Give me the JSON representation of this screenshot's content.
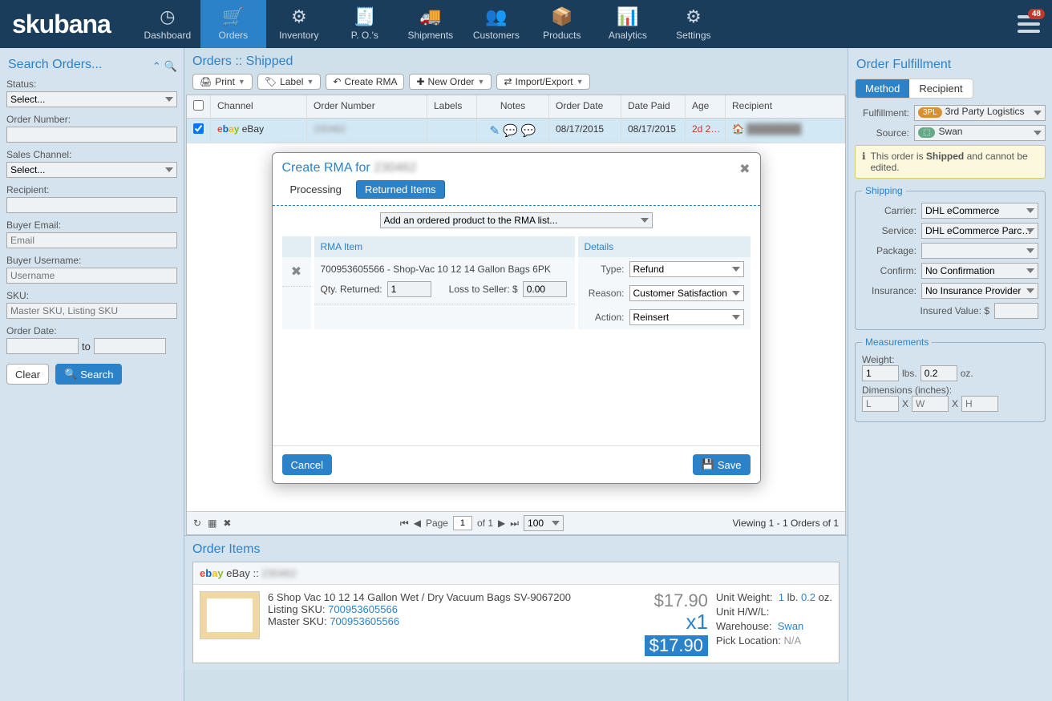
{
  "nav": {
    "logo": "skubana",
    "items": [
      "Dashboard",
      "Orders",
      "Inventory",
      "P. O.'s",
      "Shipments",
      "Customers",
      "Products",
      "Analytics",
      "Settings"
    ],
    "badge": "48"
  },
  "search": {
    "title": "Search Orders...",
    "status_label": "Status:",
    "status_value": "Select...",
    "ordernum_label": "Order Number:",
    "saleschan_label": "Sales Channel:",
    "saleschan_value": "Select...",
    "recipient_label": "Recipient:",
    "recipient_ph": "",
    "buyeremail_label": "Buyer Email:",
    "buyeremail_ph": "Email",
    "buyeruser_label": "Buyer Username:",
    "buyeruser_ph": "Username",
    "sku_label": "SKU:",
    "sku_ph": "Master SKU, Listing SKU",
    "orderdate_label": "Order Date:",
    "to": "to",
    "clear": "Clear",
    "search_btn": "Search"
  },
  "main": {
    "breadcrumb": "Orders :: Shipped",
    "btn_print": "Print",
    "btn_label": "Label",
    "btn_rma": "Create RMA",
    "btn_new": "New Order",
    "btn_imp": "Import/Export",
    "cols": {
      "channel": "Channel",
      "order": "Order Number",
      "labels": "Labels",
      "notes": "Notes",
      "odate": "Order Date",
      "pdate": "Date Paid",
      "age": "Age",
      "recipient": "Recipient"
    },
    "row": {
      "channel": "eBay",
      "order": "230462",
      "odate": "08/17/2015",
      "pdate": "08/17/2015",
      "age": "2d 2…"
    },
    "pager": {
      "page_lbl": "Page",
      "page": "1",
      "of": "of 1",
      "size": "100",
      "viewing": "Viewing 1 - 1 Orders of 1"
    }
  },
  "items": {
    "title": "Order Items",
    "head": "eBay :: ",
    "ordnum": "230462",
    "name": "6 Shop Vac 10 12 14 Gallon Wet / Dry Vacuum Bags SV-9067200",
    "lsku_lbl": "Listing SKU:",
    "lsku": "700953605566",
    "msku_lbl": "Master SKU:",
    "msku": "700953605566",
    "price": "$17.90",
    "qty": "x1",
    "total": "$17.90",
    "spec": {
      "uw_lbl": "Unit Weight:",
      "uw_lb": "1",
      "uw_lb_unit": "lb.",
      "uw_oz": "0.2",
      "uw_oz_unit": "oz.",
      "uhwl": "Unit H/W/L:",
      "wh_lbl": "Warehouse:",
      "wh": "Swan",
      "pl_lbl": "Pick Location:",
      "pl": "N/A"
    }
  },
  "fulfill": {
    "title": "Order Fulfillment",
    "tab_method": "Method",
    "tab_recipient": "Recipient",
    "ful_lbl": "Fulfillment:",
    "ful_val": "3rd Party Logistics",
    "src_lbl": "Source:",
    "src_val": "Swan",
    "info_pre": "This order is ",
    "info_b": "Shipped",
    "info_post": " and cannot be edited.",
    "ship": {
      "legend": "Shipping",
      "carrier_lbl": "Carrier:",
      "carrier": "DHL eCommerce",
      "service_lbl": "Service:",
      "service": "DHL eCommerce Parc…",
      "package_lbl": "Package:",
      "package": "",
      "confirm_lbl": "Confirm:",
      "confirm": "No Confirmation",
      "ins_lbl": "Insurance:",
      "ins": "No Insurance Provider",
      "insv_lbl": "Insured Value: $"
    },
    "meas": {
      "legend": "Measurements",
      "weight_lbl": "Weight:",
      "lbs": "1",
      "lbs_u": "lbs.",
      "oz": "0.2",
      "oz_u": "oz.",
      "dim_lbl": "Dimensions (inches):",
      "L": "L",
      "W": "W",
      "H": "H",
      "x": "X"
    }
  },
  "modal": {
    "title_pre": "Create RMA for ",
    "title_num": "230462",
    "tab_proc": "Processing",
    "tab_ret": "Returned Items",
    "add_ph": "Add an ordered product to the RMA list...",
    "col_item": "RMA Item",
    "col_details": "Details",
    "item_sku": "700953605566",
    "item_sep": " - ",
    "item_name": "Shop-Vac 10 12 14 Gallon Bags 6PK",
    "qty_lbl": "Qty. Returned:",
    "qty": "1",
    "loss_lbl": "Loss to Seller: $",
    "loss": "0.00",
    "type_lbl": "Type:",
    "type": "Refund",
    "reason_lbl": "Reason:",
    "reason": "Customer Satisfaction",
    "action_lbl": "Action:",
    "action": "Reinsert",
    "cancel": "Cancel",
    "save": "Save"
  }
}
